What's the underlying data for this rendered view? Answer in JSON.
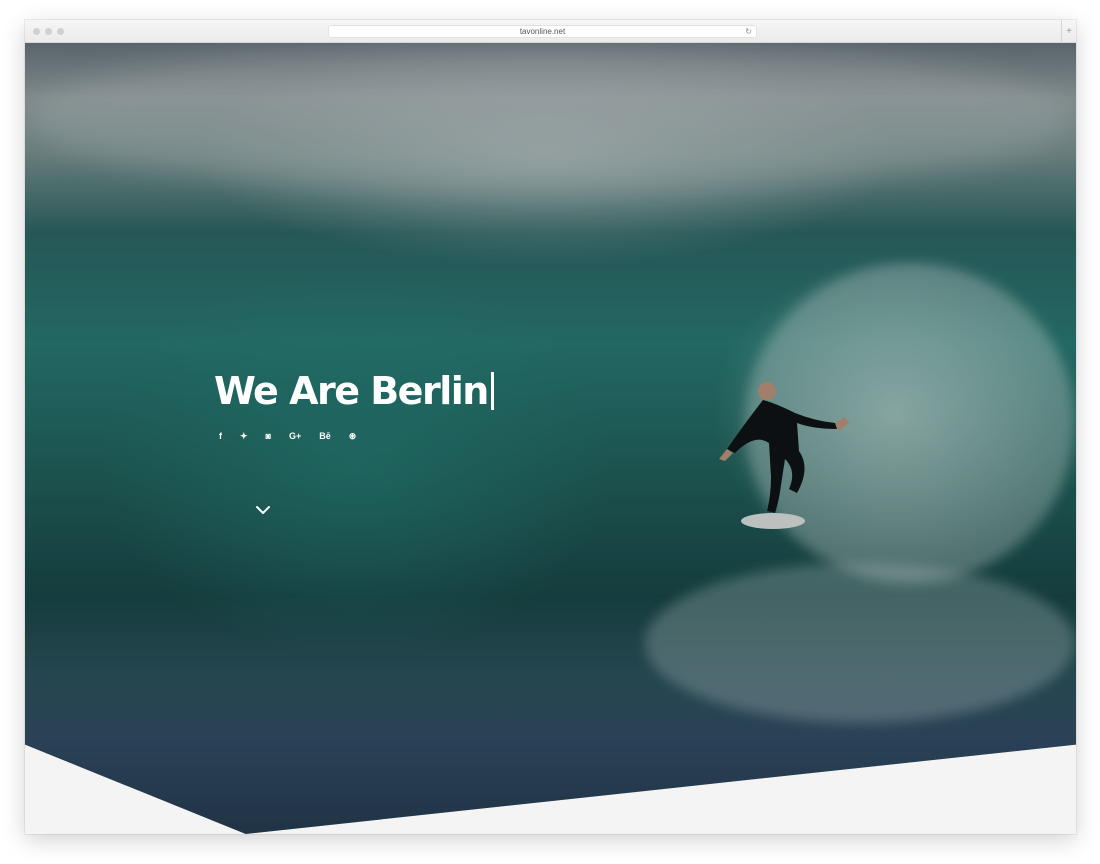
{
  "browser": {
    "url": "tavonline.net"
  },
  "hero": {
    "title": "We Are Berlin",
    "social": [
      {
        "icon": "facebook-icon",
        "label": "f"
      },
      {
        "icon": "twitter-icon",
        "label": "✦"
      },
      {
        "icon": "instagram-icon",
        "label": "◙"
      },
      {
        "icon": "google-plus-icon",
        "label": "G+"
      },
      {
        "icon": "behance-icon",
        "label": "Bē"
      },
      {
        "icon": "dribbble-icon",
        "label": "⊛"
      }
    ],
    "scroll_icon": "chevron-down-icon"
  },
  "colors": {
    "page_bg": "#f4f4f4",
    "hero_text": "#ffffff",
    "wave_teal": "#2b7f79"
  }
}
